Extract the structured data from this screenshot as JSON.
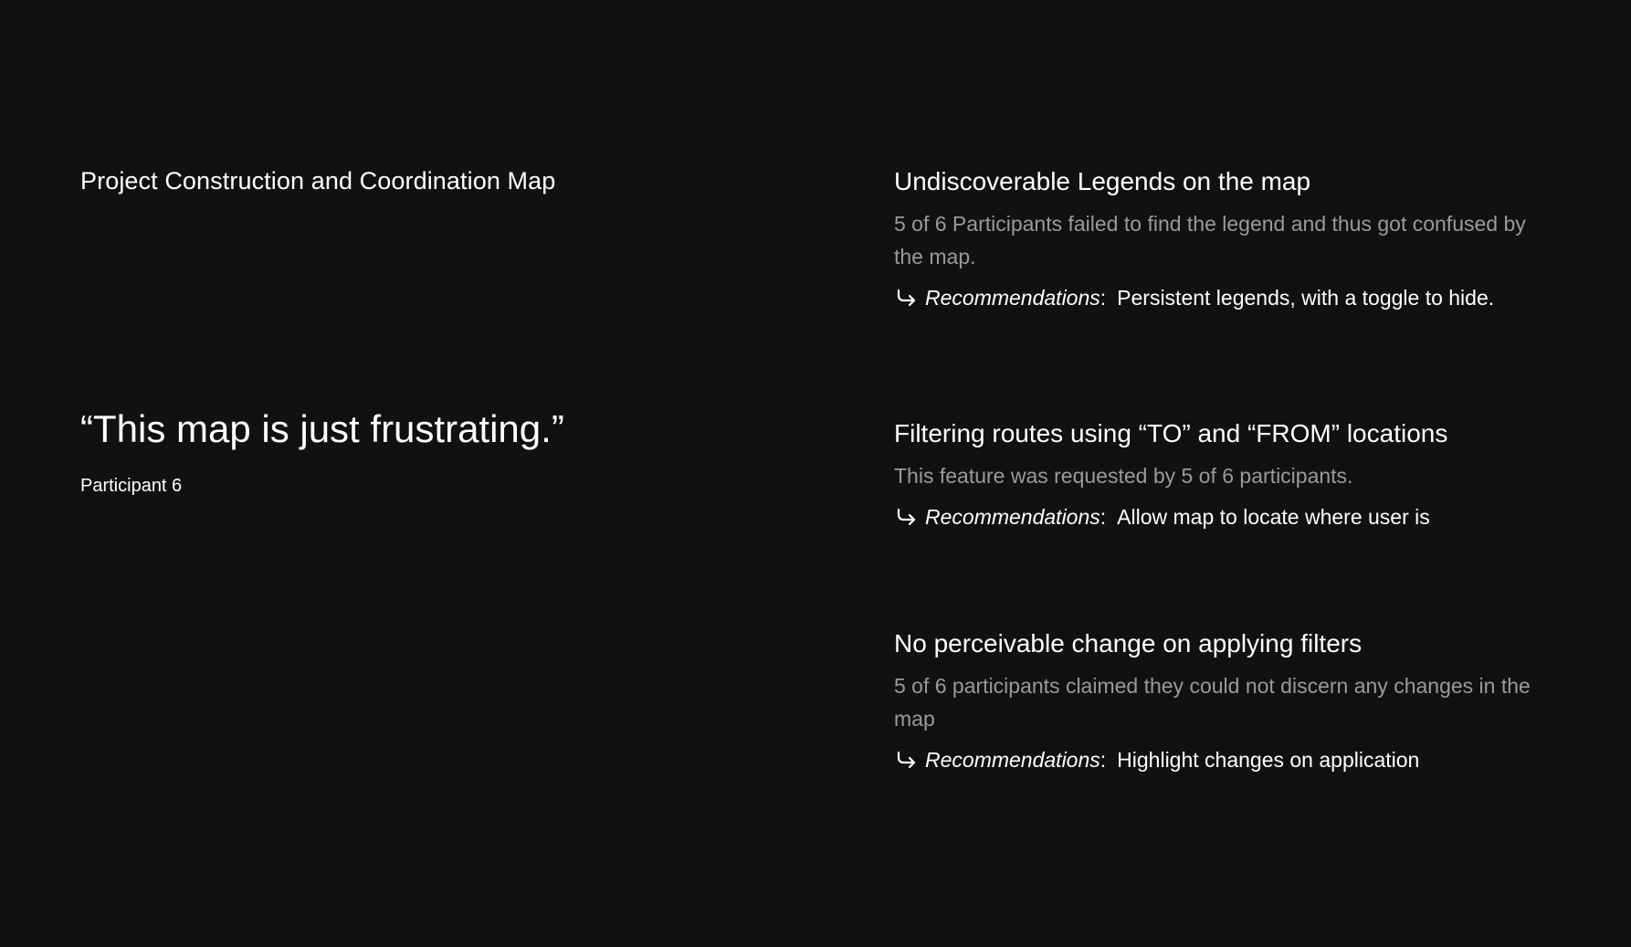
{
  "left": {
    "title": "Project Construction and Coordination Map",
    "quote": "“This map is just frustrating.”",
    "quote_attribution": "Participant 6"
  },
  "findings": [
    {
      "title": "Undiscoverable Legends on the map",
      "description": "5 of 6 Participants failed to find the legend and thus got confused by the map.",
      "rec_label": "Recommendations",
      "rec_text": "Persistent legends, with a toggle to hide."
    },
    {
      "title": "Filtering routes using “TO” and “FROM” locations",
      "description": "This feature was requested by 5 of 6 participants.",
      "rec_label": "Recommendations",
      "rec_text": "Allow map to locate where user is"
    },
    {
      "title": "No perceivable change on applying filters",
      "description": "5 of 6 participants claimed they could not discern any changes in the map",
      "rec_label": "Recommendations",
      "rec_text": "Highlight changes on application"
    }
  ],
  "rec_separator": ":",
  "colors": {
    "background": "#111111",
    "text": "#ffffff",
    "muted": "#9a9a9a"
  },
  "icons": {
    "recommendation": "return-arrow-icon"
  }
}
